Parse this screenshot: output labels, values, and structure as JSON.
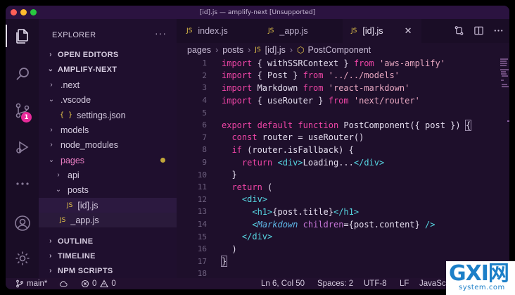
{
  "window": {
    "title": "[id].js — amplify-next [Unsupported]"
  },
  "activity_bar": {
    "items": [
      {
        "name": "explorer",
        "icon": "files-icon"
      },
      {
        "name": "search",
        "icon": "search-icon"
      },
      {
        "name": "source-control",
        "icon": "source-control-icon",
        "badge": "1"
      },
      {
        "name": "run-debug",
        "icon": "run-debug-icon"
      },
      {
        "name": "more",
        "icon": "more-icon"
      },
      {
        "name": "accounts",
        "icon": "account-icon"
      },
      {
        "name": "manage",
        "icon": "gear-icon"
      }
    ]
  },
  "sidebar": {
    "title": "EXPLORER",
    "more": "···",
    "open_editors": "OPEN EDITORS",
    "project": "AMPLIFY-NEXT",
    "tree": [
      ".next",
      ".vscode",
      "settings.json",
      "models",
      "node_modules",
      "pages",
      "api",
      "posts",
      "[id].js",
      "_app.js"
    ],
    "json_glyph": "{ }",
    "js_glyph": "JS",
    "outline": "OUTLINE",
    "timeline": "TIMELINE",
    "npm_scripts": "NPM SCRIPTS"
  },
  "tabs": [
    {
      "label": "index.js",
      "badge": "JS"
    },
    {
      "label": "_app.js",
      "badge": "JS"
    },
    {
      "label": "[id].js",
      "badge": "JS",
      "active": true
    }
  ],
  "tab_close": "✕",
  "breadcrumb": {
    "parts": [
      "pages",
      "posts",
      "[id].js",
      "PostComponent"
    ],
    "sep": "›"
  },
  "editor": {
    "line_numbers": [
      "1",
      "2",
      "3",
      "4",
      "5",
      "6",
      "7",
      "8",
      "9",
      "10",
      "11",
      "12",
      "13",
      "14",
      "15",
      "16",
      "17",
      "18"
    ]
  },
  "statusbar": {
    "branch": "main*",
    "errors": "0",
    "warnings": "0",
    "position": "Ln 6, Col 50",
    "spaces": "Spaces: 2",
    "encoding": "UTF-8",
    "eol": "LF",
    "language": "JavaScript"
  },
  "watermark": {
    "big": "GXI网",
    "small": "system.com"
  },
  "colors": {
    "background": "#1e0f2b",
    "keyword": "#ef45a6",
    "string": "#e6a6bf",
    "tag": "#57d7e3",
    "badge": "#e82a9a"
  }
}
